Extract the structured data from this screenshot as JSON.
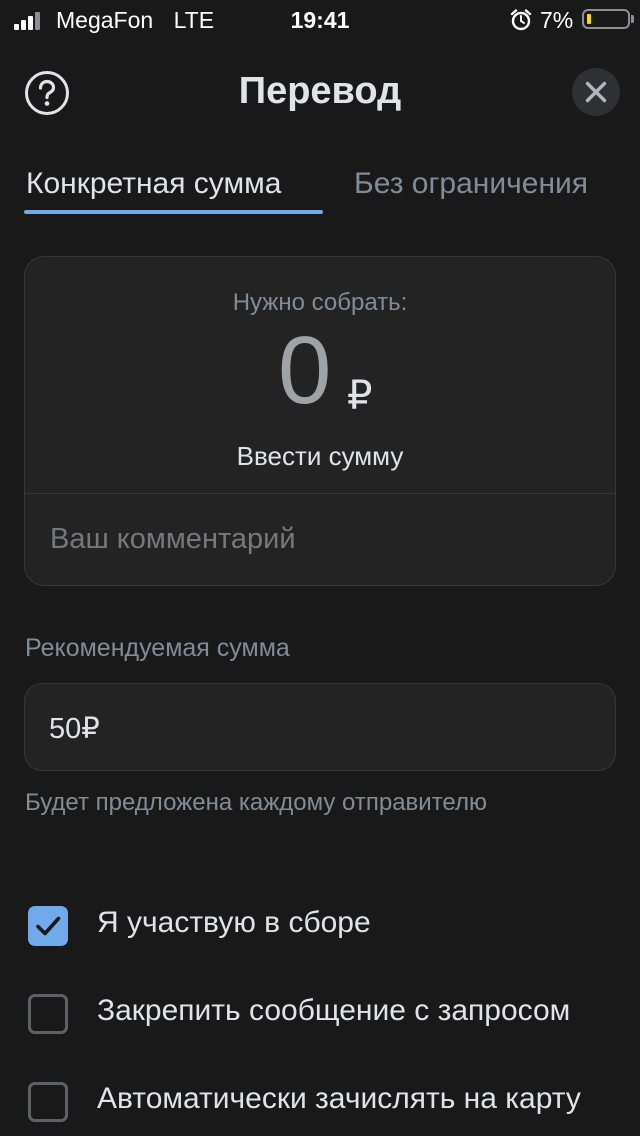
{
  "status_bar": {
    "carrier": "MegaFon",
    "network": "LTE",
    "time": "19:41",
    "battery": "7%",
    "battery_color": "#ffd60a"
  },
  "header": {
    "title": "Перевод",
    "help_icon": "question-circle-icon",
    "close_icon": "close-icon"
  },
  "tabs": [
    {
      "label": "Конкретная сумма",
      "active": true
    },
    {
      "label": "Без ограничения",
      "active": false
    }
  ],
  "amount_card": {
    "label": "Нужно собрать:",
    "amount": "0",
    "currency": "₽",
    "enter_sum": "Ввести сумму",
    "comment_placeholder": "Ваш комментарий"
  },
  "recommended": {
    "label": "Рекомендуемая сумма",
    "value": "50₽",
    "hint": "Будет предложена каждому отправителю"
  },
  "options": [
    {
      "label": "Я участвую в сборе",
      "checked": true
    },
    {
      "label": "Закрепить сообщение с запросом",
      "checked": false
    },
    {
      "label": "Автоматически зачислять на карту",
      "checked": false
    }
  ],
  "colors": {
    "accent": "#71aaeb",
    "background": "#19191a",
    "text": "#e1e3e6",
    "secondary_text": "#818c99"
  }
}
